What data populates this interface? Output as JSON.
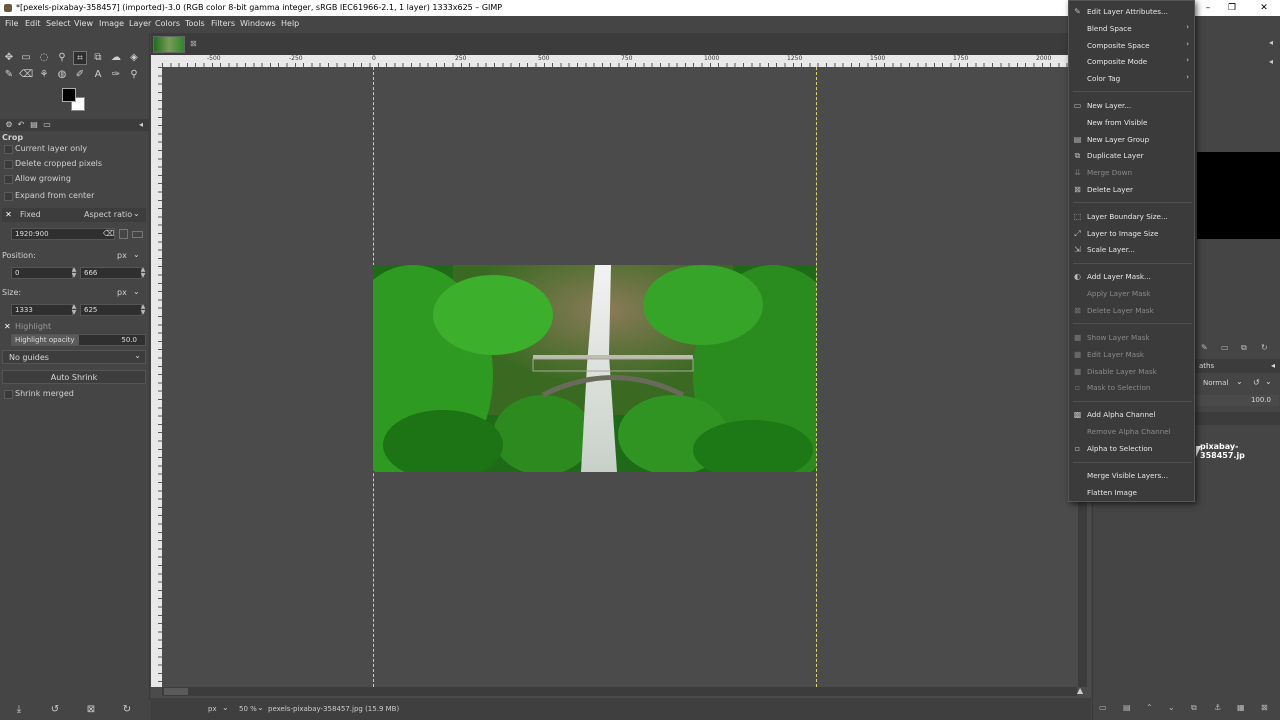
{
  "window": {
    "title": "*[pexels-pixabay-358457] (imported)-3.0 (RGB color 8-bit gamma integer, sRGB IEC61966-2.1, 1 layer) 1333x625 – GIMP",
    "minimize": "–",
    "maximize": "❐",
    "close": "✕"
  },
  "menubar": [
    "File",
    "Edit",
    "Select",
    "View",
    "Image",
    "Layer",
    "Colors",
    "Tools",
    "Filters",
    "Windows",
    "Help"
  ],
  "tool_options": {
    "title": "Crop",
    "current_layer_only": "Current layer only",
    "delete_cropped": "Delete cropped pixels",
    "allow_growing": "Allow growing",
    "expand_center": "Expand from center",
    "fixed_label": "Fixed",
    "fixed_mode": "Aspect ratio",
    "ratio_value": "1920:900",
    "position_label": "Position:",
    "position_unit": "px",
    "position_x": "0",
    "position_y": "666",
    "size_label": "Size:",
    "size_unit": "px",
    "size_w": "1333",
    "size_h": "625",
    "highlight": "Highlight",
    "highlight_opacity_label": "Highlight opacity",
    "highlight_opacity_value": "50.0",
    "guides": "No guides",
    "auto_shrink": "Auto Shrink",
    "shrink_merged": "Shrink merged"
  },
  "ruler": {
    "ticks": [
      "-500",
      "-250",
      "0",
      "250",
      "500",
      "750",
      "1000",
      "1250",
      "1500",
      "1750",
      "2000"
    ]
  },
  "status": {
    "unit": "px",
    "zoom": "50 %",
    "file": "pexels-pixabay-358457.jpg (15.9 MB)"
  },
  "layers_panel": {
    "tab_partial": "aths",
    "mode": "Normal",
    "opacity": "100.0",
    "layer_name": "pixabay-358457.jp"
  },
  "context_menu": {
    "items": [
      {
        "label": "Edit Layer Attributes...",
        "enabled": true,
        "icon": "edit-icon"
      },
      {
        "label": "Blend Space",
        "enabled": true,
        "submenu": true
      },
      {
        "label": "Composite Space",
        "enabled": true,
        "submenu": true
      },
      {
        "label": "Composite Mode",
        "enabled": true,
        "submenu": true
      },
      {
        "label": "Color Tag",
        "enabled": true,
        "submenu": true
      },
      {
        "label": "New Layer...",
        "enabled": true,
        "icon": "new-layer-icon"
      },
      {
        "label": "New from Visible",
        "enabled": true
      },
      {
        "label": "New Layer Group",
        "enabled": true,
        "icon": "folder-icon"
      },
      {
        "label": "Duplicate Layer",
        "enabled": true,
        "icon": "duplicate-icon"
      },
      {
        "label": "Merge Down",
        "enabled": false,
        "icon": "merge-icon"
      },
      {
        "label": "Delete Layer",
        "enabled": true,
        "icon": "delete-icon"
      },
      {
        "label": "Layer Boundary Size...",
        "enabled": true,
        "icon": "boundary-icon"
      },
      {
        "label": "Layer to Image Size",
        "enabled": true,
        "icon": "resize-icon"
      },
      {
        "label": "Scale Layer...",
        "enabled": true,
        "icon": "scale-icon"
      },
      {
        "label": "Add Layer Mask...",
        "enabled": true,
        "icon": "mask-icon"
      },
      {
        "label": "Apply Layer Mask",
        "enabled": false
      },
      {
        "label": "Delete Layer Mask",
        "enabled": false,
        "icon": "delete-icon"
      },
      {
        "label": "Show Layer Mask",
        "enabled": false,
        "icon": "checkbox-icon"
      },
      {
        "label": "Edit Layer Mask",
        "enabled": false,
        "icon": "checkbox-icon"
      },
      {
        "label": "Disable Layer Mask",
        "enabled": false,
        "icon": "checkbox-icon"
      },
      {
        "label": "Mask to Selection",
        "enabled": false,
        "icon": "selection-icon"
      },
      {
        "label": "Add Alpha Channel",
        "enabled": true,
        "icon": "alpha-icon"
      },
      {
        "label": "Remove Alpha Channel",
        "enabled": false
      },
      {
        "label": "Alpha to Selection",
        "enabled": true,
        "icon": "selection-icon"
      },
      {
        "label": "Merge Visible Layers...",
        "enabled": true
      },
      {
        "label": "Flatten Image",
        "enabled": true
      }
    ]
  }
}
